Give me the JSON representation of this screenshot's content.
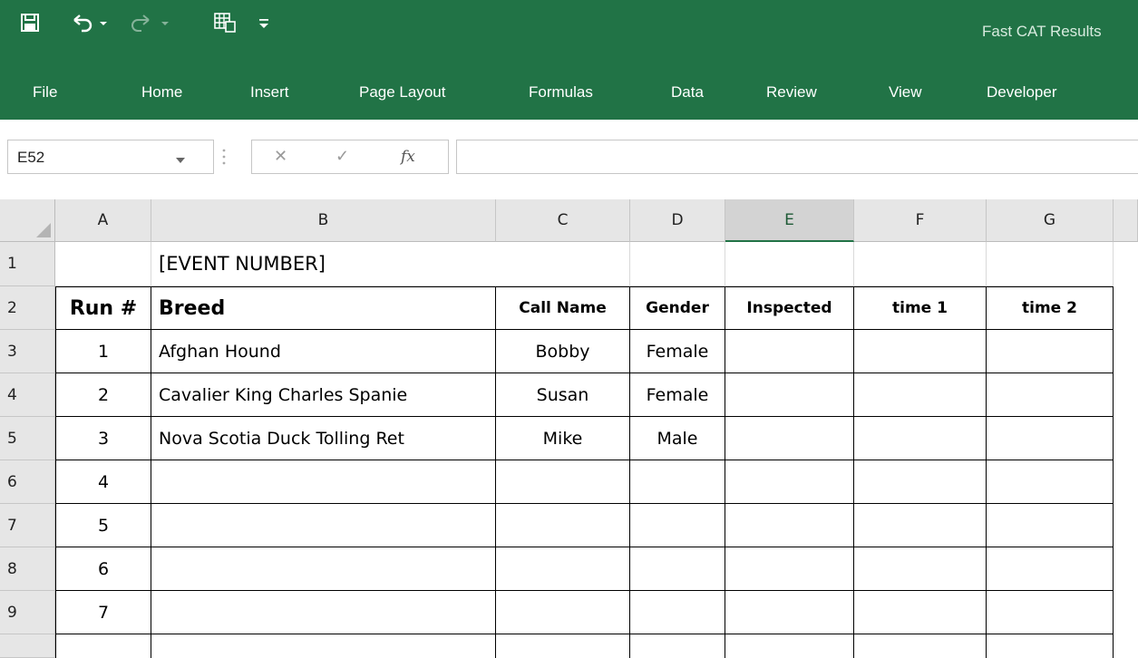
{
  "window": {
    "app_title": "Fast CAT Results",
    "qat": [
      "save-icon",
      "undo-icon",
      "redo-icon",
      "form-icon",
      "customize-icon"
    ]
  },
  "ribbon": {
    "tabs": [
      "File",
      "Home",
      "Insert",
      "Page Layout",
      "Formulas",
      "Data",
      "Review",
      "View",
      "Developer"
    ]
  },
  "formula_bar": {
    "name_box": "E52",
    "cancel": "✕",
    "enter": "✓",
    "fx": "fx",
    "content": ""
  },
  "sheet": {
    "columns": [
      "A",
      "B",
      "C",
      "D",
      "E",
      "F",
      "G"
    ],
    "selected_column": "E",
    "rows": [
      "1",
      "2",
      "3",
      "4",
      "5",
      "6",
      "7",
      "8",
      "9"
    ],
    "title": "[EVENT NUMBER]",
    "headers": [
      "Run #",
      "Breed",
      "Call Name",
      "Gender",
      "Inspected",
      "time 1",
      "time 2"
    ],
    "data": [
      {
        "run": "1",
        "breed": "Afghan Hound",
        "call_name": "Bobby",
        "gender": "Female",
        "inspected": "",
        "time1": "",
        "time2": ""
      },
      {
        "run": "2",
        "breed": "Cavalier King Charles Spanie",
        "call_name": "Susan",
        "gender": "Female",
        "inspected": "",
        "time1": "",
        "time2": ""
      },
      {
        "run": "3",
        "breed": "Nova Scotia Duck Tolling Ret",
        "call_name": "Mike",
        "gender": "Male",
        "inspected": "",
        "time1": "",
        "time2": ""
      },
      {
        "run": "4",
        "breed": "",
        "call_name": "",
        "gender": "",
        "inspected": "",
        "time1": "",
        "time2": ""
      },
      {
        "run": "5",
        "breed": "",
        "call_name": "",
        "gender": "",
        "inspected": "",
        "time1": "",
        "time2": ""
      },
      {
        "run": "6",
        "breed": "",
        "call_name": "",
        "gender": "",
        "inspected": "",
        "time1": "",
        "time2": ""
      },
      {
        "run": "7",
        "breed": "",
        "call_name": "",
        "gender": "",
        "inspected": "",
        "time1": "",
        "time2": ""
      }
    ]
  },
  "colors": {
    "accent": "#217346",
    "header_bg": "#e6e6e6",
    "gridline": "#d9d9d9"
  }
}
